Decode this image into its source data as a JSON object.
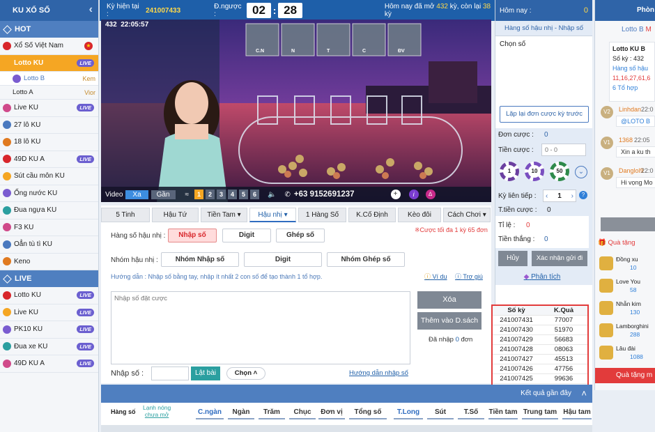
{
  "sidebar": {
    "header": "KU XỔ SỐ",
    "hot_label": "HOT",
    "hot_items": [
      {
        "label": "Xổ Số Việt Nam",
        "badge": ""
      },
      {
        "label": "Lotto KU",
        "badge": "LIVE"
      },
      {
        "label": "Lotto B",
        "badge": "",
        "tag": "Kem"
      },
      {
        "label": "Lotto A",
        "badge": "",
        "tag": "Vior"
      },
      {
        "label": "Live KU",
        "badge": "LIVE"
      },
      {
        "label": "27 lô KU",
        "badge": ""
      },
      {
        "label": "18 lô KU",
        "badge": ""
      },
      {
        "label": "49D KU A",
        "badge": "LIVE"
      },
      {
        "label": "Sút cầu môn KU",
        "badge": ""
      },
      {
        "label": "Ống nước KU",
        "badge": ""
      },
      {
        "label": "Đua ngựa KU",
        "badge": ""
      },
      {
        "label": "F3 KU",
        "badge": ""
      },
      {
        "label": "Oẳn tù tì KU",
        "badge": ""
      },
      {
        "label": "Keno",
        "badge": ""
      }
    ],
    "live_label": "LIVE",
    "live_items": [
      {
        "label": "Lotto KU",
        "badge": "LIVE"
      },
      {
        "label": "Live KU",
        "badge": "LIVE"
      },
      {
        "label": "PK10 KU",
        "badge": "LIVE"
      },
      {
        "label": "Đua xe KU",
        "badge": "LIVE"
      },
      {
        "label": "49D KU A",
        "badge": "LIVE"
      }
    ]
  },
  "topbar": {
    "ky_label": "Kỳ hiện tại :",
    "ky_value": "241007433",
    "countdown_label": "Đ.ngược :",
    "minutes": "02",
    "seconds": "28",
    "today_prefix": "Hôm nay đã mở",
    "opened": "432",
    "left_prefix": "kỳ, còn lại",
    "left": "38",
    "left_suffix": "kỳ"
  },
  "video": {
    "overlay_ky": "432",
    "overlay_time": "22:05:57",
    "ball_labels": [
      "C.N",
      "N",
      "T",
      "C",
      "ĐV"
    ],
    "video_label": "Video",
    "btn_xa": "Xa",
    "btn_gan": "Gần",
    "numbers": [
      "1",
      "2",
      "3",
      "4",
      "5",
      "6"
    ],
    "phone": "+63 9152691237"
  },
  "bet": {
    "tabs": [
      "5 Tinh",
      "Hậu Tứ",
      "Tiền Tam",
      "Hậu nhị",
      "1 Hàng Số",
      "K.Cố Định",
      "Kèo đôi",
      "Cách Chơi"
    ],
    "limit_note": "※Cược tối đa 1 kỳ 65 đơn",
    "hang_label": "Hàng số hậu nhị :",
    "hang_buttons": [
      "Nhập số",
      "Digit",
      "Ghép số"
    ],
    "nhom_label": "Nhóm hậu nhị :",
    "nhom_buttons": [
      "Nhóm Nhập số",
      "Digit",
      "Nhóm Ghép số"
    ],
    "guide": "Hướng dẫn : Nhập số bằng tay, nhập ít nhất 2 con số để tạo thành 1 tổ hợp.",
    "vidu": "Ví dụ",
    "trogiup": "Trợ giú",
    "textarea_placeholder": "Nhập số đặt cược",
    "btn_xoa": "Xóa",
    "btn_them": "Thêm vào D.sách",
    "da_nhap_prefix": "Đã nhập",
    "da_nhap_count": "0",
    "da_nhap_suffix": "đơn",
    "nhap_so_label": "Nhập số :",
    "btn_lat_bai": "Lật bài",
    "btn_chon": "Chọn",
    "huong_dan_link": "Hướng dẫn nhập số"
  },
  "right": {
    "today_label": "Hôm nay :",
    "today_value": "0",
    "section_title": "Hàng số hậu nhị - Nhập số",
    "chon_so": "Chọn số",
    "btn_lap_lai": "Lặp lại đơn cược kỳ trước",
    "don_cuoc_label": "Đơn cược :",
    "don_cuoc_value": "0",
    "tien_cuoc_label": "Tiền cược :",
    "tien_cuoc_placeholder": "0 - 0",
    "chips": [
      "1",
      "10",
      "50"
    ],
    "ky_lien_tiep_label": "Kỳ liên tiếp :",
    "ky_lien_tiep_value": "1",
    "t_tien_cuoc_label": "T.tiền cược :",
    "t_tien_cuoc_value": "0",
    "ti_le_label": "Tỉ lệ :",
    "ti_le_value": "0",
    "tien_thang_label": "Tiền thắng :",
    "tien_thang_value": "0",
    "btn_huy": "Hủy",
    "btn_xac_nhan": "Xác nhận gửi đi",
    "phan_tich": "Phân tích",
    "results_headers": [
      "Số kỳ",
      "K.Quả"
    ],
    "results": [
      [
        "241007431",
        "77007"
      ],
      [
        "241007430",
        "51970"
      ],
      [
        "241007429",
        "56683"
      ],
      [
        "241007428",
        "08063"
      ],
      [
        "241007427",
        "45513"
      ],
      [
        "241007426",
        "47756"
      ],
      [
        "241007425",
        "99636"
      ],
      [
        "241007424",
        "25543"
      ]
    ]
  },
  "chat": {
    "title": "Phòn",
    "room": "Lotto B",
    "room2": "M",
    "card_title": "Lotto KU B",
    "card_ky": "Số kỳ : 432",
    "card_line": "Hàng số hậu",
    "card_nums": "11,16,27,61,6",
    "card_tohop": "6 Tổ hợp",
    "messages": [
      {
        "level": "V2",
        "name": "Linhdan",
        "time": "22:0",
        "text": "@LOTO B"
      },
      {
        "level": "V1",
        "name": "1368",
        "time": "22:05",
        "text": "Xin a ku th"
      },
      {
        "level": "V1",
        "name": "Danglol9",
        "time": "22:0",
        "text": "Hi vọng Mo"
      }
    ],
    "gift_title": "Quà tặng",
    "gifts": [
      {
        "name": "Đồng xu",
        "price": "10"
      },
      {
        "name": "Love You",
        "price": "58"
      },
      {
        "name": "Nhẫn kim",
        "price": "130"
      },
      {
        "name": "Lamborghini",
        "price": "288"
      },
      {
        "name": "Lâu đài",
        "price": "1088"
      }
    ],
    "gift_footer": "Quà tặng m"
  },
  "bottom": {
    "ket_qua": "Kết quả gần đây",
    "hang_so": "Hàng số",
    "lanh_nong": "Lạnh nóng",
    "chua_mo": "chưa mở",
    "cols": [
      "C.ngàn",
      "Ngàn",
      "Trăm",
      "Chục",
      "Đơn vị",
      "Tổng số",
      "T.Long",
      "Sút",
      "T.Số",
      "Tiền tam",
      "Trung tam",
      "Hậu tam"
    ]
  }
}
